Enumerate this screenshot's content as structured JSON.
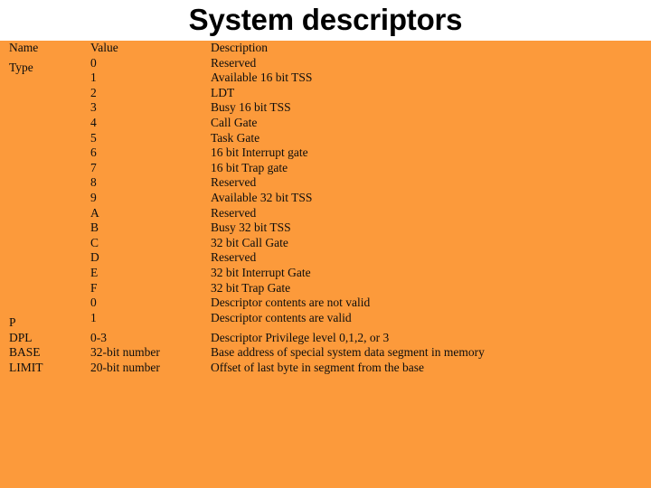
{
  "slide": {
    "title": "System descriptors",
    "background_color": "#fc9a3b",
    "title_color": "#000000",
    "border_color": "#1a1a1a"
  },
  "table": {
    "headers": {
      "name": "Name",
      "value": "Value",
      "description": "Description"
    },
    "sections": [
      {
        "name": "Type",
        "rows": [
          {
            "value": "0",
            "description": "Reserved"
          },
          {
            "value": "1",
            "description": "Available 16 bit TSS"
          },
          {
            "value": "2",
            "description": "LDT"
          },
          {
            "value": "3",
            "description": "Busy 16 bit TSS"
          },
          {
            "value": "4",
            "description": "Call Gate"
          },
          {
            "value": "5",
            "description": "Task Gate"
          },
          {
            "value": "6",
            "description": "16 bit Interrupt gate"
          },
          {
            "value": "7",
            "description": "16 bit Trap gate"
          },
          {
            "value": "8",
            "description": "Reserved"
          },
          {
            "value": "9",
            "description": "Available 32 bit TSS"
          },
          {
            "value": "A",
            "description": "Reserved"
          },
          {
            "value": "B",
            "description": "Busy 32 bit TSS"
          },
          {
            "value": "C",
            "description": "32 bit Call Gate"
          },
          {
            "value": "D",
            "description": "Reserved"
          },
          {
            "value": "E",
            "description": "32 bit Interrupt Gate"
          },
          {
            "value": "F",
            "description": "32 bit Trap Gate"
          }
        ]
      },
      {
        "name": "P",
        "rows": [
          {
            "value": "0",
            "description": "Descriptor contents are not valid"
          },
          {
            "value": "1",
            "description": "Descriptor contents are valid"
          }
        ]
      },
      {
        "name": "DPL",
        "rows": [
          {
            "value": "0-3",
            "description": "Descriptor Privilege level 0,1,2, or 3"
          }
        ]
      },
      {
        "name": "BASE",
        "rows": [
          {
            "value": "32-bit number",
            "description": "Base address of special system data segment in memory"
          }
        ]
      },
      {
        "name": "LIMIT",
        "rows": [
          {
            "value": "20-bit number",
            "description": "Offset of last byte in segment from the base"
          }
        ]
      }
    ]
  }
}
